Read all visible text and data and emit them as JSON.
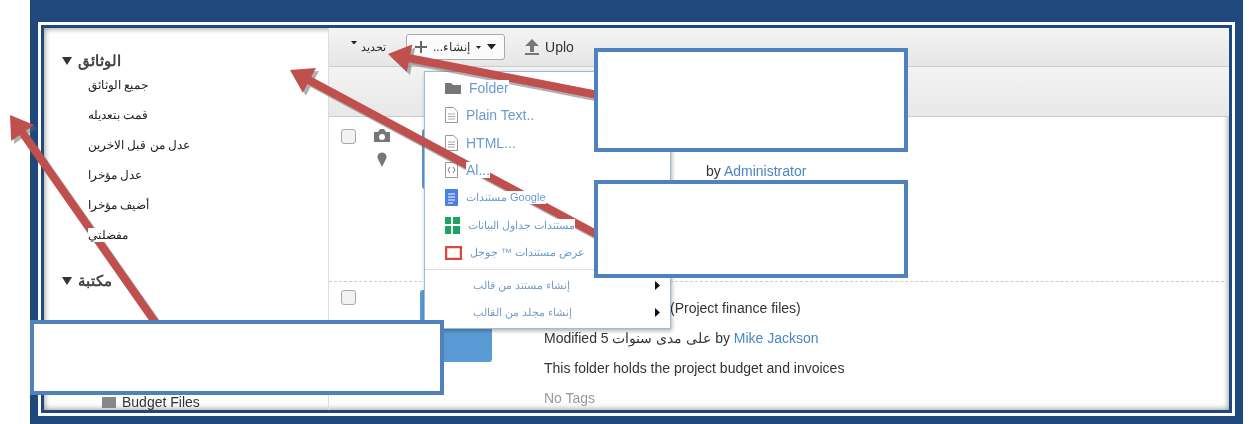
{
  "sidebar": {
    "sections": [
      {
        "title": "الوثائق",
        "expanded": true,
        "items": [
          "جميع الوثائق",
          "قمت بتعديله",
          "عدل من قبل الاخرين",
          "عدل مؤخرا",
          "أضيف مؤخرا",
          "مفضلتي"
        ]
      },
      {
        "title": "مكتبة",
        "expanded": true
      }
    ],
    "tree_item": "Budget Files"
  },
  "toolbar": {
    "select": "تحديد",
    "create": "...إنشاء",
    "upload": "Uplo"
  },
  "create_menu": {
    "items": [
      {
        "kind": "folder",
        "label": "Folder"
      },
      {
        "kind": "text",
        "label": "Plain Text.."
      },
      {
        "kind": "text",
        "label": "HTML..."
      },
      {
        "kind": "code",
        "label": "Al..."
      },
      {
        "kind": "gdoc",
        "label": "مستندات Google"
      },
      {
        "kind": "gsheet",
        "label": "مستندات جداول البيانات"
      },
      {
        "kind": "gslide",
        "label": "عرض مستندات ™ جوجل"
      },
      {
        "kind": "submenu",
        "label": "إنشاء مستند من قالب"
      },
      {
        "kind": "submenu",
        "label": "إنشاء مجلد من القالب"
      }
    ]
  },
  "rows": [
    {
      "checked": false,
      "by": "by",
      "author": "Administrator"
    },
    {
      "checked": false,
      "title": "(Project finance files)",
      "modified": "Modified 5 على مدى سنوات by",
      "author": "Mike Jackson",
      "description": "This folder holds the project budget and invoices",
      "tags": "No Tags"
    }
  ]
}
